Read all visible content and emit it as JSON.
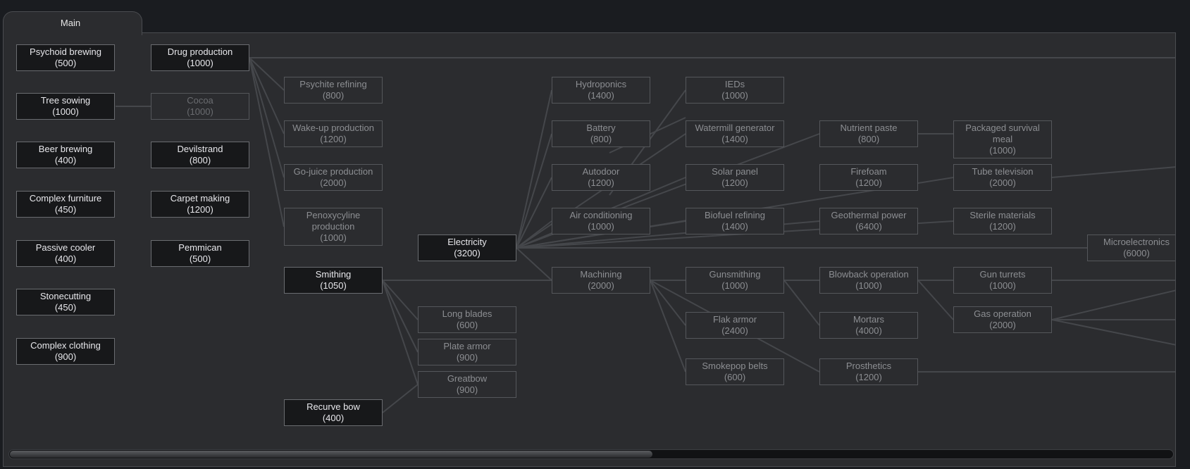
{
  "tab": {
    "label": "Main"
  },
  "projects": [
    {
      "id": "psychoid-brewing",
      "name": "Psychoid brewing",
      "cost": "(500)",
      "state": "done"
    },
    {
      "id": "tree-sowing",
      "name": "Tree sowing",
      "cost": "(1000)",
      "state": "done"
    },
    {
      "id": "beer-brewing",
      "name": "Beer brewing",
      "cost": "(400)",
      "state": "done"
    },
    {
      "id": "complex-furniture",
      "name": "Complex furniture",
      "cost": "(450)",
      "state": "done"
    },
    {
      "id": "passive-cooler",
      "name": "Passive cooler",
      "cost": "(400)",
      "state": "done"
    },
    {
      "id": "stonecutting",
      "name": "Stonecutting",
      "cost": "(450)",
      "state": "done"
    },
    {
      "id": "complex-clothing",
      "name": "Complex clothing",
      "cost": "(900)",
      "state": "done"
    },
    {
      "id": "drug-production",
      "name": "Drug production",
      "cost": "(1000)",
      "state": "done"
    },
    {
      "id": "cocoa",
      "name": "Cocoa",
      "cost": "(1000)",
      "state": "dim"
    },
    {
      "id": "devilstrand",
      "name": "Devilstrand",
      "cost": "(800)",
      "state": "done"
    },
    {
      "id": "carpet-making",
      "name": "Carpet making",
      "cost": "(1200)",
      "state": "done"
    },
    {
      "id": "pemmican",
      "name": "Pemmican",
      "cost": "(500)",
      "state": "done"
    },
    {
      "id": "psychite-refining",
      "name": "Psychite refining",
      "cost": "(800)",
      "state": "avail"
    },
    {
      "id": "wake-up-production",
      "name": "Wake-up production",
      "cost": "(1200)",
      "state": "avail"
    },
    {
      "id": "go-juice-production",
      "name": "Go-juice production",
      "cost": "(2000)",
      "state": "avail"
    },
    {
      "id": "penoxycyline-production",
      "name": "Penoxycyline production",
      "cost": "(1000)",
      "state": "avail"
    },
    {
      "id": "smithing",
      "name": "Smithing",
      "cost": "(1050)",
      "state": "done"
    },
    {
      "id": "recurve-bow",
      "name": "Recurve bow",
      "cost": "(400)",
      "state": "done"
    },
    {
      "id": "electricity",
      "name": "Electricity",
      "cost": "(3200)",
      "state": "done"
    },
    {
      "id": "long-blades",
      "name": "Long blades",
      "cost": "(600)",
      "state": "avail"
    },
    {
      "id": "plate-armor",
      "name": "Plate armor",
      "cost": "(900)",
      "state": "avail"
    },
    {
      "id": "greatbow",
      "name": "Greatbow",
      "cost": "(900)",
      "state": "avail"
    },
    {
      "id": "hydroponics",
      "name": "Hydroponics",
      "cost": "(1400)",
      "state": "avail"
    },
    {
      "id": "battery",
      "name": "Battery",
      "cost": "(800)",
      "state": "avail"
    },
    {
      "id": "autodoor",
      "name": "Autodoor",
      "cost": "(1200)",
      "state": "avail"
    },
    {
      "id": "air-conditioning",
      "name": "Air conditioning",
      "cost": "(1000)",
      "state": "avail"
    },
    {
      "id": "machining",
      "name": "Machining",
      "cost": "(2000)",
      "state": "avail"
    },
    {
      "id": "ieds",
      "name": "IEDs",
      "cost": "(1000)",
      "state": "avail"
    },
    {
      "id": "watermill-generator",
      "name": "Watermill generator",
      "cost": "(1400)",
      "state": "avail"
    },
    {
      "id": "solar-panel",
      "name": "Solar panel",
      "cost": "(1200)",
      "state": "avail"
    },
    {
      "id": "biofuel-refining",
      "name": "Biofuel refining",
      "cost": "(1400)",
      "state": "avail"
    },
    {
      "id": "gunsmithing",
      "name": "Gunsmithing",
      "cost": "(1000)",
      "state": "avail"
    },
    {
      "id": "flak-armor",
      "name": "Flak armor",
      "cost": "(2400)",
      "state": "avail"
    },
    {
      "id": "smokepop-belts",
      "name": "Smokepop belts",
      "cost": "(600)",
      "state": "avail"
    },
    {
      "id": "nutrient-paste",
      "name": "Nutrient paste",
      "cost": "(800)",
      "state": "avail"
    },
    {
      "id": "firefoam",
      "name": "Firefoam",
      "cost": "(1200)",
      "state": "avail"
    },
    {
      "id": "geothermal-power",
      "name": "Geothermal power",
      "cost": "(6400)",
      "state": "avail"
    },
    {
      "id": "blowback-operation",
      "name": "Blowback operation",
      "cost": "(1000)",
      "state": "avail"
    },
    {
      "id": "mortars",
      "name": "Mortars",
      "cost": "(4000)",
      "state": "avail"
    },
    {
      "id": "prosthetics",
      "name": "Prosthetics",
      "cost": "(1200)",
      "state": "avail"
    },
    {
      "id": "packaged-survival-meal",
      "name": "Packaged survival meal",
      "cost": "(1000)",
      "state": "avail"
    },
    {
      "id": "tube-television",
      "name": "Tube television",
      "cost": "(2000)",
      "state": "avail"
    },
    {
      "id": "sterile-materials",
      "name": "Sterile materials",
      "cost": "(1200)",
      "state": "avail"
    },
    {
      "id": "gun-turrets",
      "name": "Gun turrets",
      "cost": "(1000)",
      "state": "avail"
    },
    {
      "id": "gas-operation",
      "name": "Gas operation",
      "cost": "(2000)",
      "state": "avail"
    },
    {
      "id": "microelectronics",
      "name": "Microelectronics",
      "cost": "(6000)",
      "state": "avail"
    }
  ],
  "colors": {
    "line": "#45474b",
    "done_bg": "#17181a",
    "panel_bg": "#2b2c2f"
  }
}
